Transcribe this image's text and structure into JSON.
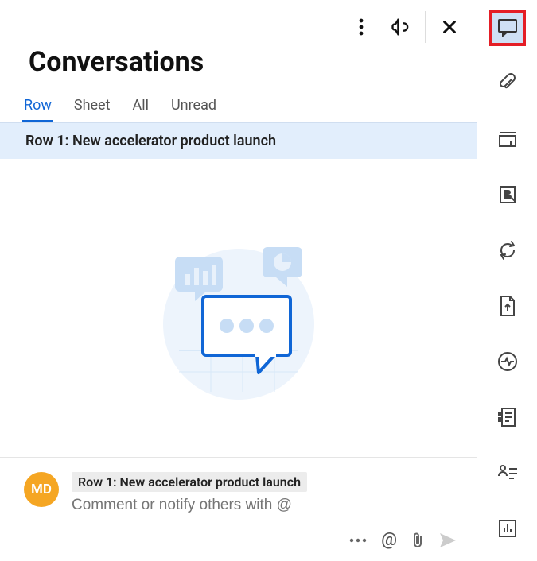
{
  "header": {
    "title": "Conversations"
  },
  "tabs": [
    {
      "label": "Row",
      "active": true
    },
    {
      "label": "Sheet",
      "active": false
    },
    {
      "label": "All",
      "active": false
    },
    {
      "label": "Unread",
      "active": false
    }
  ],
  "selected_row_banner": "Row 1: New accelerator product launch",
  "composer": {
    "avatar_initials": "MD",
    "row_chip": "Row 1: New accelerator product launch",
    "placeholder": "Comment or notify others with @"
  },
  "composer_toolbar": {
    "more": "…",
    "mention": "@",
    "attach": "attach",
    "send": "send"
  },
  "sidebar_icons": [
    "comment-icon",
    "attachments-icon",
    "proofs-icon",
    "brandfolder-icon",
    "refresh-icon",
    "upload-icon",
    "activity-icon",
    "summary-icon",
    "resource-icon",
    "chart-icon"
  ]
}
